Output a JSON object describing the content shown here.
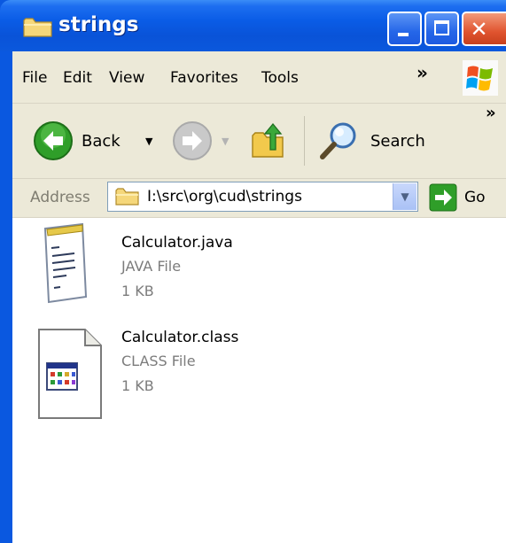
{
  "window": {
    "title": "strings"
  },
  "menu": {
    "items": [
      "File",
      "Edit",
      "View",
      "Favorites",
      "Tools"
    ],
    "overflow": "»"
  },
  "toolbar": {
    "back_label": "Back",
    "search_label": "Search",
    "overflow": "»"
  },
  "address": {
    "label": "Address",
    "value": "I:\\src\\org\\cud\\strings",
    "go_label": "Go"
  },
  "files": [
    {
      "name": "Calculator.java",
      "type": "JAVA File",
      "size": "1 KB",
      "icon": "java-file-icon"
    },
    {
      "name": "Calculator.class",
      "type": "CLASS File",
      "size": "1 KB",
      "icon": "class-file-icon"
    }
  ],
  "colors": {
    "titlebar": "#0a5ce6",
    "chrome": "#ece9d8",
    "close_button": "#e0542f"
  }
}
